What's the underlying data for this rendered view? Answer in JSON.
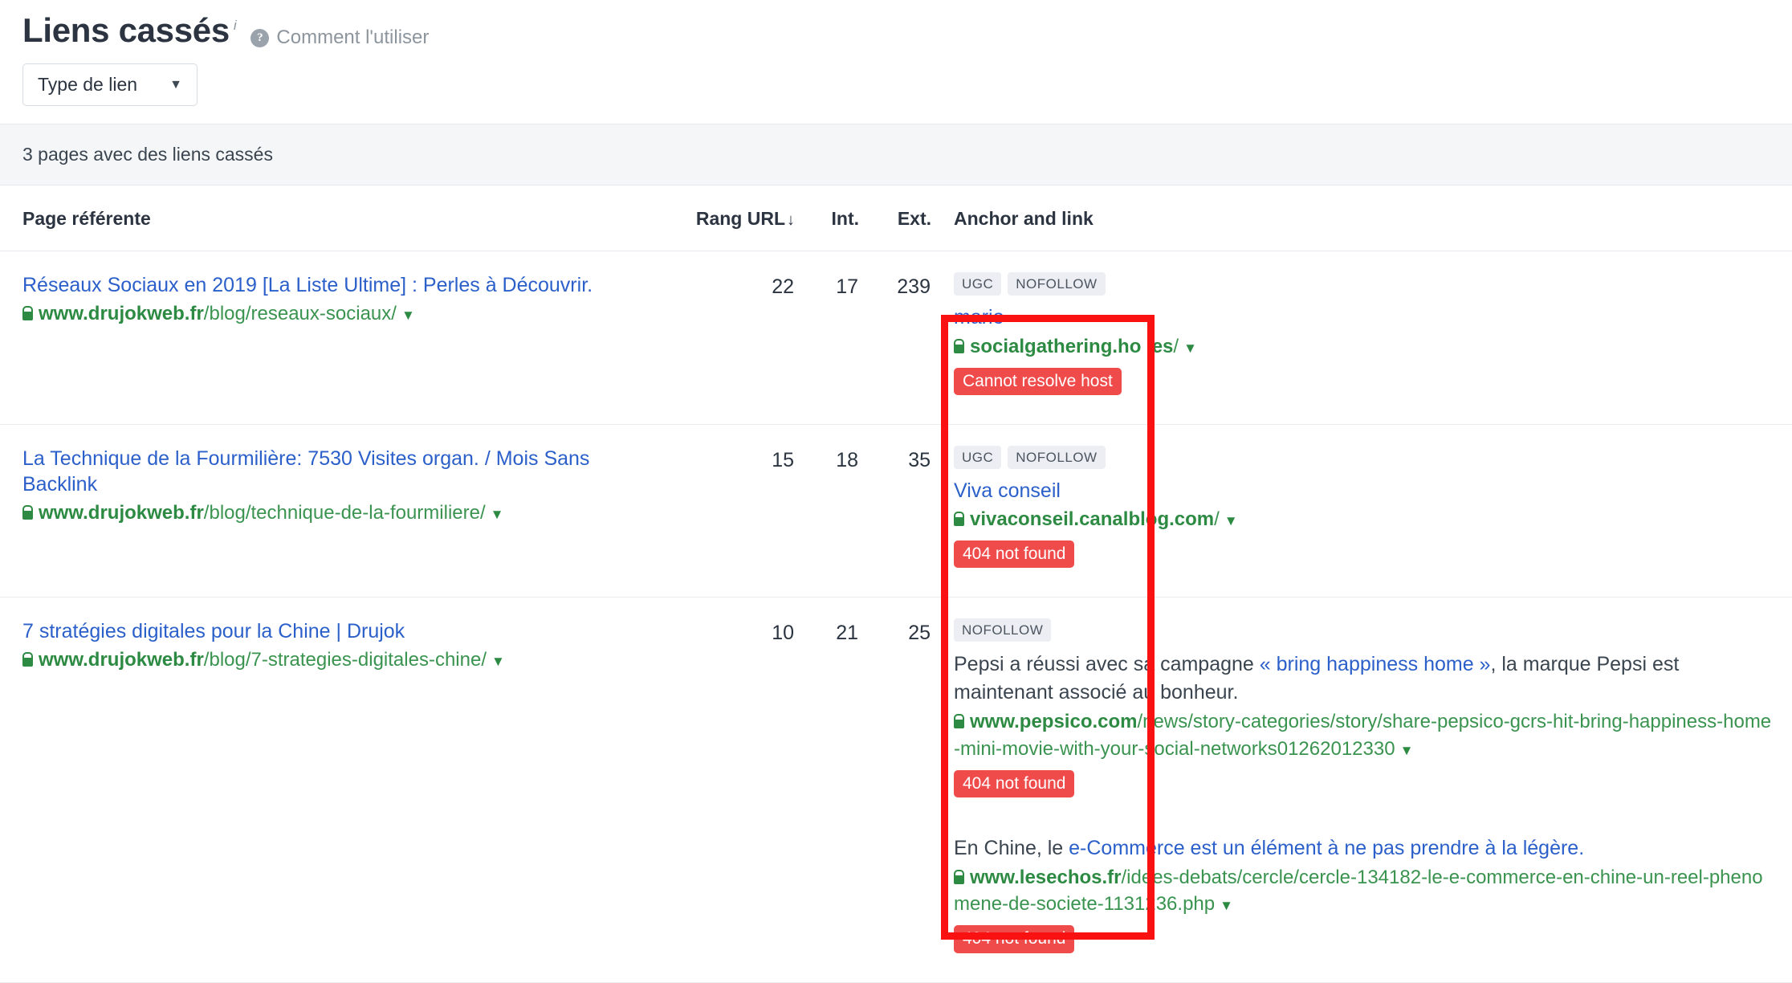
{
  "header": {
    "title": "Liens cassés",
    "title_superscript": "i",
    "help_icon": "question-mark-icon",
    "how_to_use": "Comment l'utiliser"
  },
  "filters": {
    "link_type_label": "Type de lien",
    "caret": "▼"
  },
  "summary": {
    "count_text": "3 pages avec des liens cassés"
  },
  "table": {
    "columns": {
      "referring_page": "Page référente",
      "url_rank": "Rang URL",
      "url_rank_sort": "↓",
      "internal": "Int.",
      "external": "Ext.",
      "anchor_and_link": "Anchor and link"
    },
    "rows": [
      {
        "title": "Réseaux Sociaux en 2019 [La Liste Ultime] : Perles à Découvrir.",
        "url_domain": "www.drujokweb.fr",
        "url_path": "/blog/reseaux-sociaux/",
        "url_caret": "▼",
        "rank": "22",
        "internal": "17",
        "external": "239",
        "links": [
          {
            "badges": [
              "UGC",
              "NOFOLLOW"
            ],
            "anchor": "mario",
            "context_prefix": "",
            "context_link": "",
            "context_suffix": "",
            "target_domain": "socialgathering.ho .es",
            "target_path": "/",
            "target_caret": "▼",
            "status": "Cannot resolve host"
          }
        ]
      },
      {
        "title": "La Technique de la Fourmilière: 7530 Visites organ. / Mois Sans Backlink",
        "url_domain": "www.drujokweb.fr",
        "url_path": "/blog/technique-de-la-fourmiliere/",
        "url_caret": "▼",
        "rank": "15",
        "internal": "18",
        "external": "35",
        "links": [
          {
            "badges": [
              "UGC",
              "NOFOLLOW"
            ],
            "anchor": "Viva conseil",
            "context_prefix": "",
            "context_link": "",
            "context_suffix": "",
            "target_domain": "vivaconseil.canalblog.com",
            "target_path": "/",
            "target_caret": "▼",
            "status": "404 not found"
          }
        ]
      },
      {
        "title": "7 stratégies digitales pour la Chine | Drujok",
        "url_domain": "www.drujokweb.fr",
        "url_path": "/blog/7-strategies-digitales-chine/",
        "url_caret": "▼",
        "rank": "10",
        "internal": "21",
        "external": "25",
        "links": [
          {
            "badges": [
              "NOFOLLOW"
            ],
            "anchor": "",
            "context_prefix": "Pepsi a réussi avec sa campagne ",
            "context_link": "« bring happiness home »",
            "context_suffix": ", la marque Pepsi est maintenant associé au bonheur.",
            "target_domain": "www.pepsico.com",
            "target_path": "/news/story-categories/story/share-pepsico-gcrs-hit-bring-happiness-home-mini-movie-with-your-social-networks01262012330",
            "target_caret": "▼",
            "status": "404 not found"
          },
          {
            "badges": [],
            "anchor": "",
            "context_prefix": "En Chine, le ",
            "context_link": "e-Commerce est un élément à ne pas prendre à la légère.",
            "context_suffix": "",
            "target_domain": "www.lesechos.fr",
            "target_path": "/idees-debats/cercle/cercle-134182-le-e-commerce-en-chine-un-reel-phenomene-de-societe-1131236.php",
            "target_caret": "▼",
            "status": "404 not found"
          }
        ]
      }
    ]
  },
  "annotation": {
    "type": "red-rectangle-highlight",
    "color": "#fa1111"
  }
}
